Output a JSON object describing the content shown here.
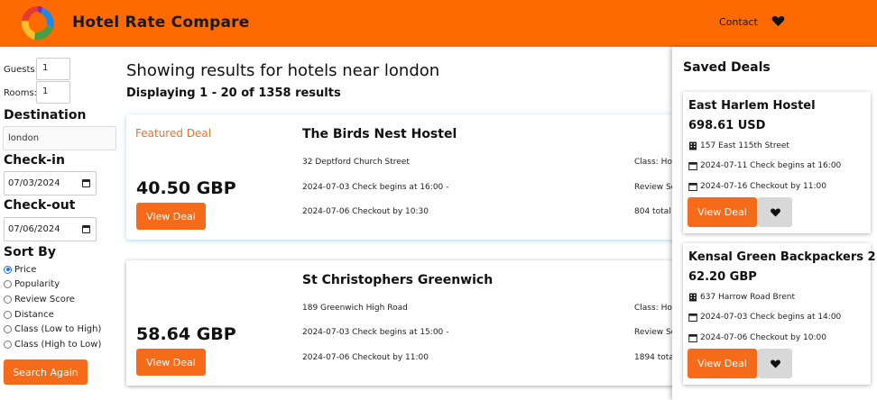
{
  "header": {
    "brand": "Hotel Rate Compare",
    "logo_icon": "logo-icon",
    "contact_label": "Contact",
    "heart_icon": "heart-icon",
    "bar_color": "#ff6a00"
  },
  "filters": {
    "guests_label": "Guests:",
    "guests_value": "1",
    "rooms_label": "Rooms:",
    "rooms_value": "1",
    "destination_label": "Destination",
    "destination_value": "london",
    "checkin_label": "Check-in",
    "checkin_value": "07/03/2024",
    "checkout_label": "Check-out",
    "checkout_value": "07/06/2024",
    "sort_label": "Sort By",
    "sort_options": [
      "Price",
      "Popularity",
      "Review Score",
      "Distance",
      "Class (Low to High)",
      "Class (High to Low)"
    ],
    "sort_selected": "Price",
    "search_button": "Search Again"
  },
  "results": {
    "title": "Showing results for hotels near london",
    "subtitle": "Displaying 1 - 20 of 1358 results",
    "hotels": [
      {
        "badge": "Featured Deal",
        "price": "40.50 GBP",
        "name": "The Birds Nest Hostel",
        "address": "32 Deptford Church Street",
        "checkin": "2024-07-03 Check begins at 16:00 -",
        "checkout": "2024-07-06 Checkout by 10:30",
        "class": "Class: Hot",
        "review": "Review Sc",
        "total": "804 total",
        "button": "View Deal"
      },
      {
        "badge": "",
        "price": "58.64 GBP",
        "name": "St Christophers Greenwich",
        "address": "189 Greenwich High Road",
        "checkin": "2024-07-03 Check begins at 15:00 -",
        "checkout": "2024-07-06 Checkout by 11:00",
        "class": "Class: Hot",
        "review": "Review Sc",
        "total": "1894 tota",
        "button": "View Deal"
      }
    ]
  },
  "saved": {
    "title": "Saved Deals",
    "deals": [
      {
        "name": "East Harlem Hostel",
        "price": "698.61 USD",
        "address": "157 East 115th Street",
        "checkin": "2024-07-11 Check begins at 16:00",
        "checkout": "2024-07-16 Checkout by 11:00",
        "button": "View Deal"
      },
      {
        "name": "Kensal Green Backpackers 2",
        "price": "62.20 GBP",
        "address": "637 Harrow Road Brent",
        "checkin": "2024-07-03 Check begins at 14:00",
        "checkout": "2024-07-06 Checkout by 10:00",
        "button": "View Deal"
      }
    ]
  },
  "colors": {
    "accent": "#f56b1a",
    "featured_text": "#e8732a",
    "radio_selected": "#1a73e8"
  }
}
